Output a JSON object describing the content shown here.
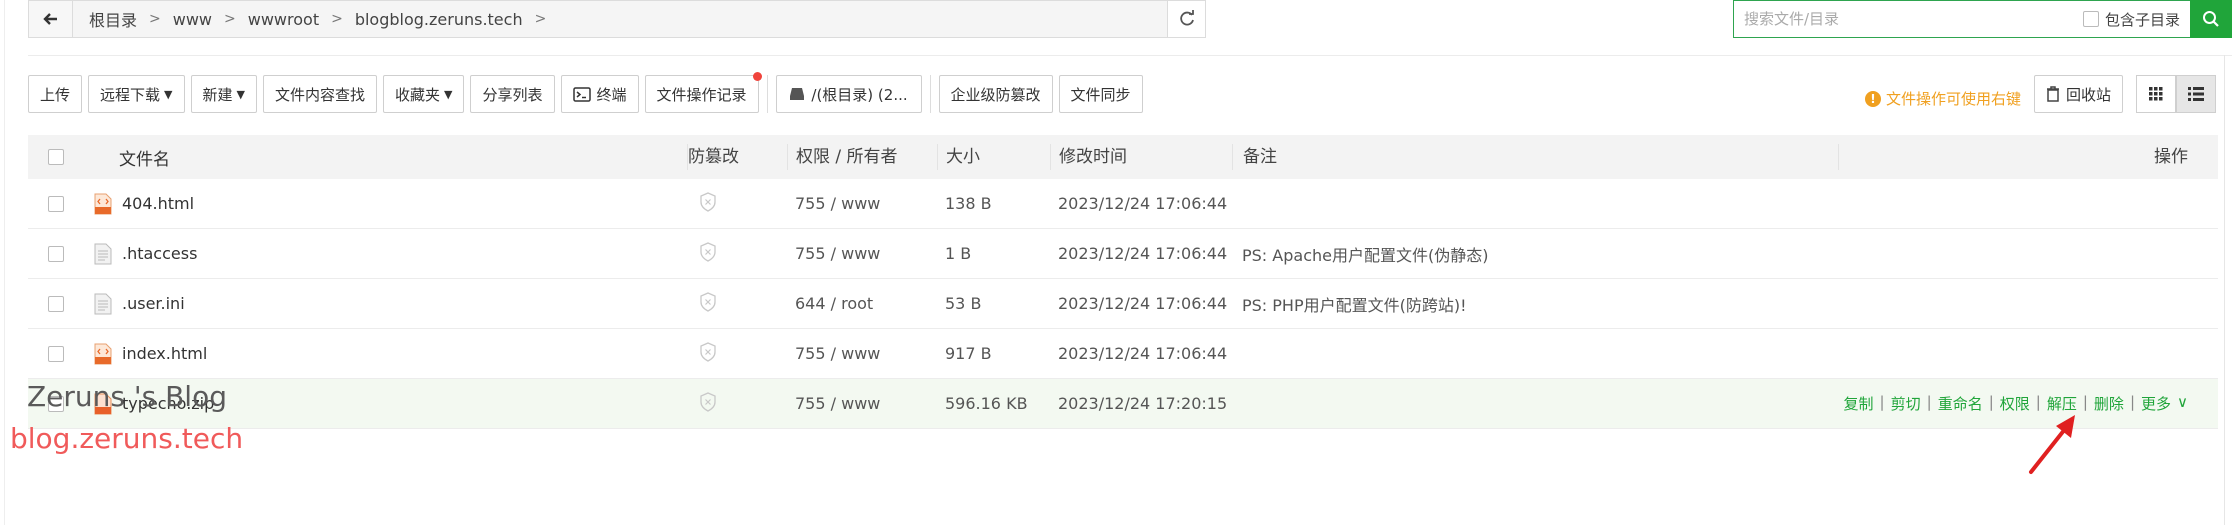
{
  "path": {
    "crumbs": [
      "根目录",
      "www",
      "wwwroot",
      "blogblog.zeruns.tech"
    ]
  },
  "search": {
    "placeholder": "搜索文件/目录",
    "subdir_label": "包含子目录"
  },
  "toolbar": {
    "upload": "上传",
    "remote_download": "远程下载",
    "new": "新建",
    "content_search": "文件内容查找",
    "favorites": "收藏夹",
    "share_list": "分享列表",
    "terminal": "终端",
    "op_log": "文件操作记录",
    "disk": "/(根目录) (2...",
    "tamper": "企业级防篡改",
    "sync": "文件同步",
    "hint": "文件操作可使用右键",
    "recycle": "回收站"
  },
  "columns": {
    "name": "文件名",
    "guard": "防篡改",
    "perm": "权限 / 所有者",
    "size": "大小",
    "time": "修改时间",
    "note": "备注",
    "action": "操作"
  },
  "files": [
    {
      "name": "404.html",
      "type": "html",
      "perm": "755 / www",
      "size": "138 B",
      "time": "2023/12/24 17:06:44",
      "note": ""
    },
    {
      "name": ".htaccess",
      "type": "text",
      "perm": "755 / www",
      "size": "1 B",
      "time": "2023/12/24 17:06:44",
      "note": "PS: Apache用户配置文件(伪静态)"
    },
    {
      "name": ".user.ini",
      "type": "text",
      "perm": "644 / root",
      "size": "53 B",
      "time": "2023/12/24 17:06:44",
      "note": "PS: PHP用户配置文件(防跨站)!"
    },
    {
      "name": "index.html",
      "type": "html",
      "perm": "755 / www",
      "size": "917 B",
      "time": "2023/12/24 17:06:44",
      "note": ""
    },
    {
      "name": "typecho.zip",
      "type": "zip",
      "perm": "755 / www",
      "size": "596.16 KB",
      "time": "2023/12/24 17:20:15",
      "note": ""
    }
  ],
  "row_actions": [
    "复制",
    "剪切",
    "重命名",
    "权限",
    "解压",
    "删除",
    "更多"
  ],
  "watermark": {
    "line1": "Zeruns 's Blog",
    "line2": "blog.zeruns.tech"
  },
  "colors": {
    "accent": "#20a53a",
    "hint": "#f0a020",
    "arrow": "#e02020",
    "watermark_url": "#f05a5a"
  }
}
